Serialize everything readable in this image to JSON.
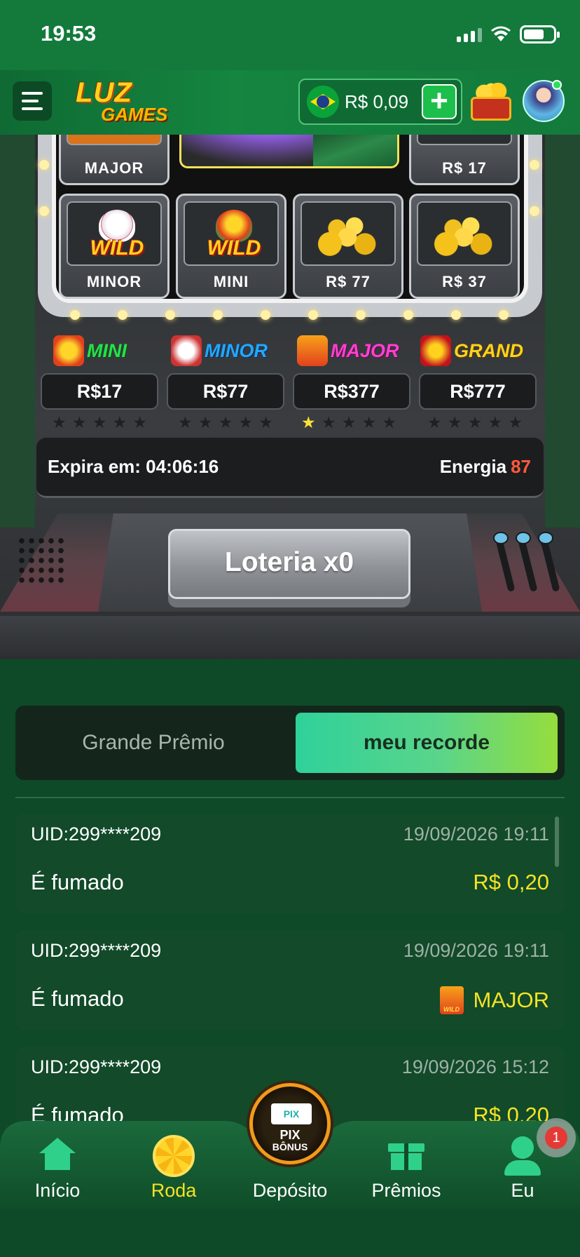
{
  "status_bar": {
    "time": "19:53"
  },
  "header": {
    "logo_top": "LUZ",
    "logo_bottom": "GAMES",
    "balance": "R$ 0,09",
    "add_label": "+"
  },
  "reels": {
    "top_row": [
      "MAJOR",
      "R$ 17"
    ],
    "bottom_row": [
      "MINOR",
      "MINI",
      "R$ 77",
      "R$ 37"
    ],
    "wild_text": "WILD"
  },
  "jackpots": [
    {
      "name": "MINI",
      "value": "R$17",
      "stars_lit": 0,
      "color": "#27e04a"
    },
    {
      "name": "MINOR",
      "value": "R$77",
      "stars_lit": 0,
      "color": "#21a8ff"
    },
    {
      "name": "MAJOR",
      "value": "R$377",
      "stars_lit": 1,
      "color": "#ff3fd0"
    },
    {
      "name": "GRAND",
      "value": "R$777",
      "stars_lit": 0,
      "color": "#ffd21d"
    }
  ],
  "info": {
    "expira": "Expira em: 04:06:16",
    "energia_label": "Energia",
    "energia_value": "87"
  },
  "lottery_button": "Loteria x0",
  "tabs": {
    "grande_premio": "Grande Prêmio",
    "meu_recorde": "meu recorde"
  },
  "records": [
    {
      "uid": "UID:299****209",
      "date": "19/09/2026 19:11",
      "status": "É fumado",
      "prize": "R$ 0,20",
      "icon": ""
    },
    {
      "uid": "UID:299****209",
      "date": "19/09/2026 19:11",
      "status": "É fumado",
      "prize": "MAJOR",
      "icon": "major-wild-icon"
    },
    {
      "uid": "UID:299****209",
      "date": "19/09/2026 15:12",
      "status": "É fumado",
      "prize": "R$ 0,20",
      "icon": ""
    }
  ],
  "bottom_nav": {
    "inicio": "Início",
    "roda": "Roda",
    "deposito": "Depósito",
    "premios": "Prêmios",
    "eu": "Eu",
    "pix_top": "PIX",
    "pix_bottom": "BÔNUS",
    "pix_label": "PIX",
    "badge_count": "1"
  }
}
